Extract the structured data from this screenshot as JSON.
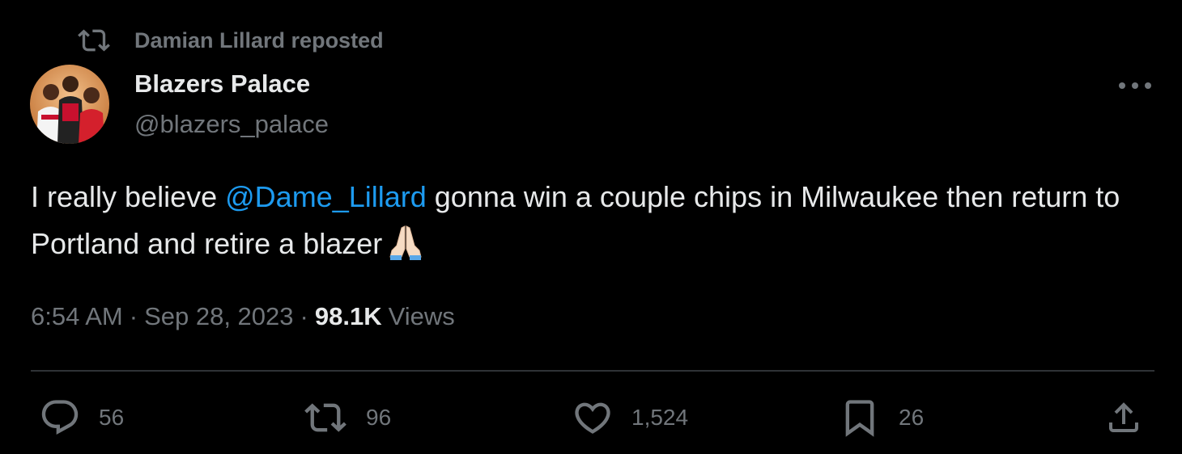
{
  "repost": {
    "text": "Damian Lillard reposted",
    "icon": "repost-icon"
  },
  "author": {
    "name": "Blazers Palace",
    "handle": "@blazers_palace",
    "avatar": "avatar"
  },
  "tweet": {
    "text_before": "I really believe ",
    "mention": "@Dame_Lillard",
    "text_after": " gonna win a couple chips in Milwaukee then return to Portland and retire a blazer",
    "emoji": "folded-hands"
  },
  "meta": {
    "time": "6:54 AM",
    "separator1": "·",
    "date": "Sep 28, 2023",
    "separator2": "·",
    "views_count": "98.1K",
    "views_label": "Views"
  },
  "actions": {
    "replies": "56",
    "reposts": "96",
    "likes": "1,524",
    "bookmarks": "26"
  },
  "colors": {
    "background": "#000000",
    "text": "#e7e9ea",
    "secondary": "#71767b",
    "accent": "#1d9bf0",
    "divider": "#2f3336"
  }
}
